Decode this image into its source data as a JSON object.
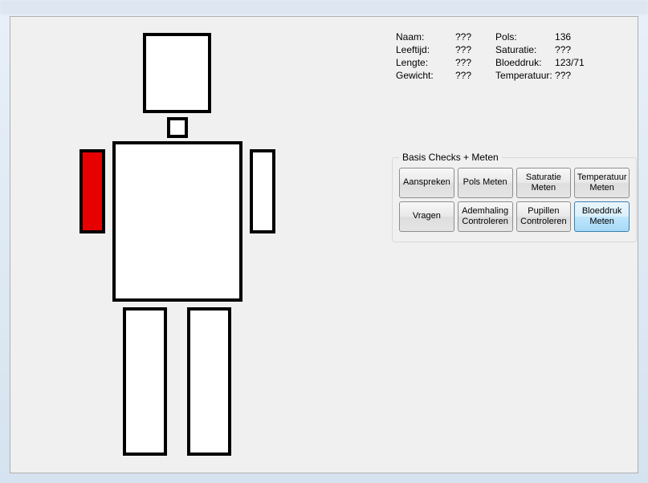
{
  "title_bar": "",
  "patient": {
    "left": [
      {
        "label": "Naam:",
        "value": "???"
      },
      {
        "label": "Leeftijd:",
        "value": "???"
      },
      {
        "label": "Lengte:",
        "value": "???"
      },
      {
        "label": "Gewicht:",
        "value": "???"
      }
    ],
    "right": [
      {
        "label": "Pols:",
        "value": "136"
      },
      {
        "label": "Saturatie:",
        "value": "???"
      },
      {
        "label": "Bloeddruk:",
        "value": "123/71"
      },
      {
        "label": "Temperatuur:",
        "value": "???"
      }
    ]
  },
  "checks": {
    "group_title": "Basis Checks + Meten",
    "row1": [
      "Aanspreken",
      "Pols Meten",
      "Saturatie Meten",
      "Temperatuur Meten"
    ],
    "row2": [
      "Vragen",
      "Ademhaling Controleren",
      "Pupillen Controleren",
      "Bloeddruk Meten"
    ]
  },
  "body_parts": {
    "head": {
      "injured": false
    },
    "neck": {
      "injured": false
    },
    "torso": {
      "injured": false
    },
    "left_upper_arm": {
      "injured": true
    },
    "right_upper_arm": {
      "injured": false
    },
    "left_leg": {
      "injured": false
    },
    "right_leg": {
      "injured": false
    }
  },
  "colors": {
    "injured": "#e60000",
    "normal": "#ffffff"
  }
}
